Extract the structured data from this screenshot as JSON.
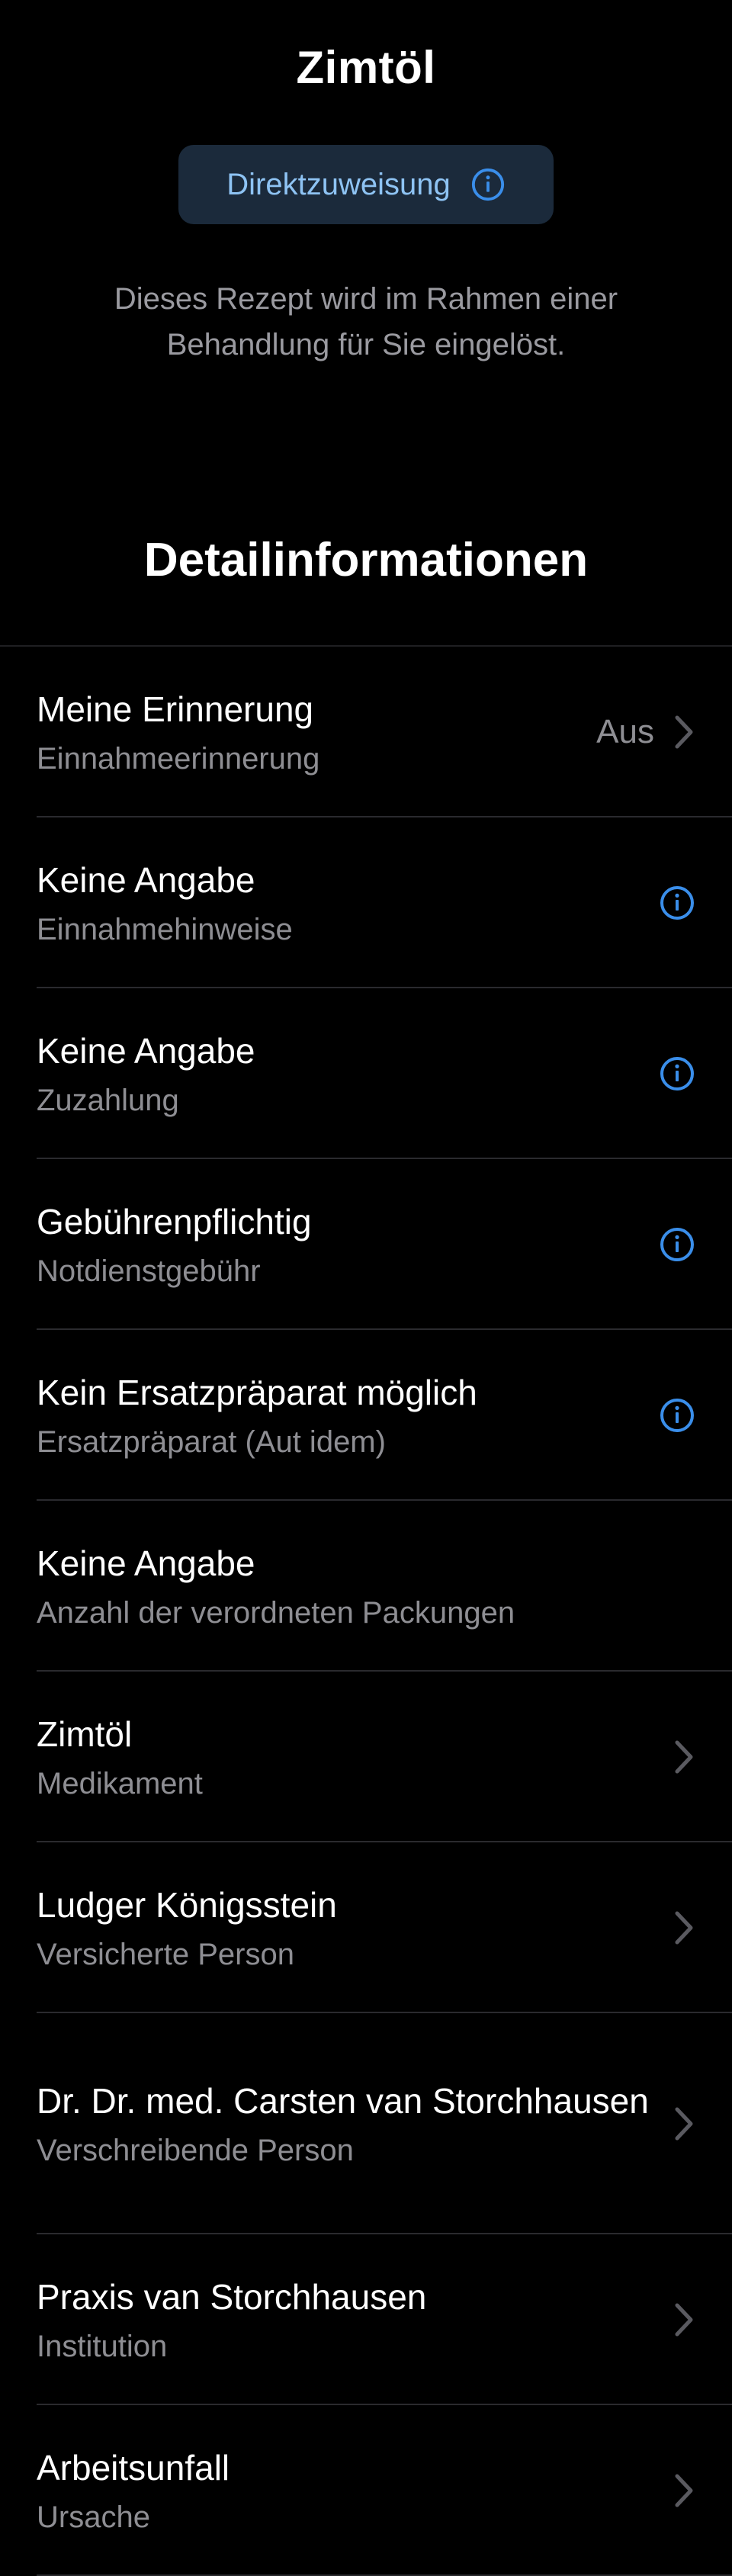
{
  "header": {
    "title": "Zimtöl",
    "badge_label": "Direktzuweisung",
    "badge_icon": "info-icon",
    "description": "Dieses Rezept wird im Rahmen einer Behandlung für Sie eingelöst."
  },
  "section": {
    "title": "Detailinformationen"
  },
  "details": [
    {
      "title": "Meine Erinnerung",
      "subtitle": "Einnahmeerinnerung",
      "value": "Aus",
      "accessory": "chevron-right-icon"
    },
    {
      "title": "Keine Angabe",
      "subtitle": "Einnahmehinweise",
      "accessory": "info-icon"
    },
    {
      "title": "Keine Angabe",
      "subtitle": "Zuzahlung",
      "accessory": "info-icon"
    },
    {
      "title": "Gebührenpflichtig",
      "subtitle": "Notdienstgebühr",
      "accessory": "info-icon"
    },
    {
      "title": "Kein Ersatzpräparat möglich",
      "subtitle": "Ersatzpräparat (Aut idem)",
      "accessory": "info-icon"
    },
    {
      "title": "Keine Angabe",
      "subtitle": "Anzahl der verordneten Packungen",
      "accessory": "none"
    },
    {
      "title": "Zimtöl",
      "subtitle": "Medikament",
      "accessory": "chevron-right-icon"
    },
    {
      "title": "Ludger Königsstein",
      "subtitle": "Versicherte Person",
      "accessory": "chevron-right-icon"
    },
    {
      "title": "Dr. Dr. med. Carsten van Storchhausen",
      "subtitle": "Verschreibende Person",
      "accessory": "chevron-right-icon"
    },
    {
      "title": "Praxis van Storchhausen",
      "subtitle": "Institution",
      "accessory": "chevron-right-icon"
    },
    {
      "title": "Arbeitsunfall",
      "subtitle": "Ursache",
      "accessory": "chevron-right-icon"
    }
  ],
  "colors": {
    "background": "#000000",
    "accent": "#3a8eea",
    "badge_background": "#1b2a3b",
    "badge_text": "#8ec3f3",
    "secondary_text": "#8e8e93",
    "separator": "#2a2a2e"
  }
}
